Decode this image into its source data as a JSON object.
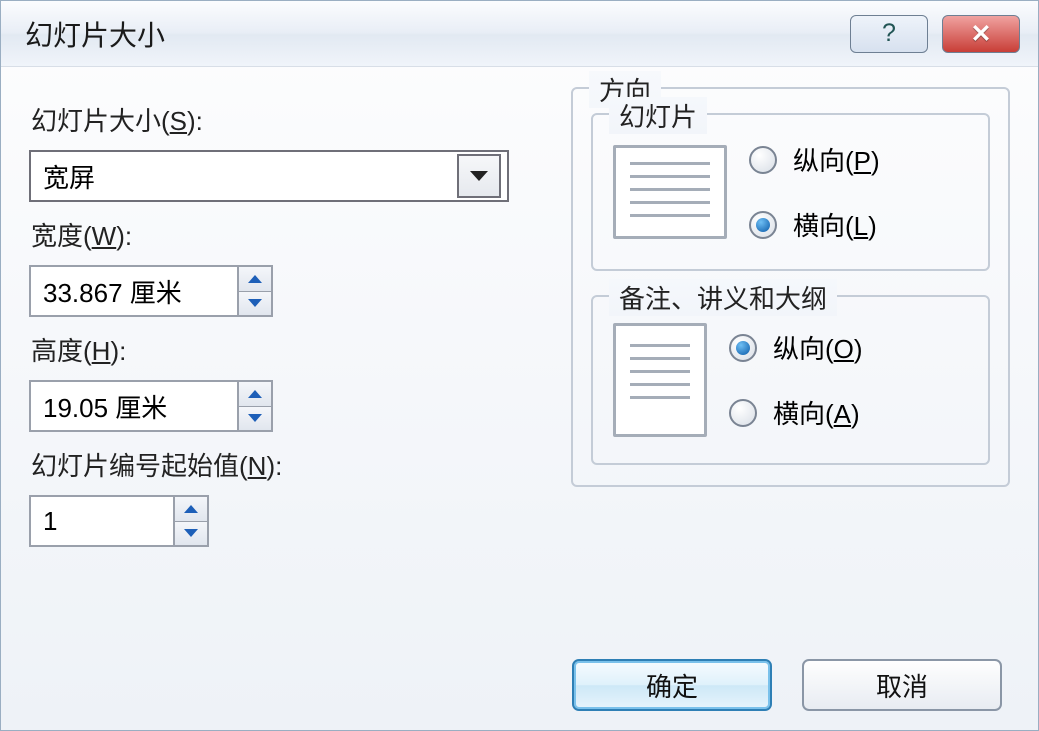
{
  "title": "幻灯片大小",
  "labels": {
    "size": {
      "text": "幻灯片大小(",
      "key": "S",
      "tail": "):"
    },
    "width": {
      "text": "宽度(",
      "key": "W",
      "tail": "):"
    },
    "height": {
      "text": "高度(",
      "key": "H",
      "tail": "):"
    },
    "startnum": {
      "text": "幻灯片编号起始值(",
      "key": "N",
      "tail": "):"
    }
  },
  "size_select": {
    "value": "宽屏"
  },
  "width_value": "33.867 厘米",
  "height_value": "19.05 厘米",
  "startnum_value": "1",
  "orientation_group": "方向",
  "slides_group": "幻灯片",
  "notes_group": "备注、讲义和大纲",
  "radios": {
    "slides_portrait": {
      "label": "纵向(",
      "key": "P",
      "tail": ")",
      "checked": false
    },
    "slides_landscape": {
      "label": "横向(",
      "key": "L",
      "tail": ")",
      "checked": true
    },
    "notes_portrait": {
      "label": "纵向(",
      "key": "O",
      "tail": ")",
      "checked": true
    },
    "notes_landscape": {
      "label": "横向(",
      "key": "A",
      "tail": ")",
      "checked": false
    }
  },
  "buttons": {
    "ok": "确定",
    "cancel": "取消"
  }
}
